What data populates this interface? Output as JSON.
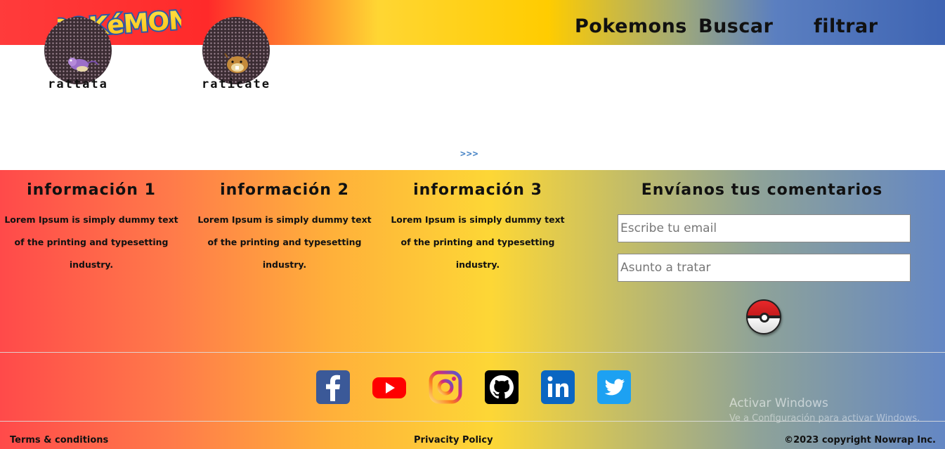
{
  "header": {
    "logo_text": "POKéMON",
    "nav": [
      "Pokemons",
      "Buscar",
      "filtrar"
    ]
  },
  "main": {
    "cards": [
      {
        "name": "rattata"
      },
      {
        "name": "raticate"
      }
    ],
    "next_label": ">>>"
  },
  "footer": {
    "info_columns": [
      {
        "title": "información 1",
        "text": "Lorem Ipsum is simply dummy text of the printing and typesetting industry."
      },
      {
        "title": "información 2",
        "text": "Lorem Ipsum is simply dummy text of the printing and typesetting industry."
      },
      {
        "title": "información 3",
        "text": "Lorem Ipsum is simply dummy text of the printing and typesetting industry."
      }
    ],
    "contact": {
      "title": "Envíanos tus comentarios",
      "email_placeholder": "Escribe tu email",
      "subject_placeholder": "Asunto a tratar"
    },
    "social": [
      {
        "icon": "facebook-icon",
        "color": "#3b5998"
      },
      {
        "icon": "youtube-icon",
        "color": "#ff0000"
      },
      {
        "icon": "instagram-icon",
        "color": "#c13584"
      },
      {
        "icon": "github-icon",
        "color": "#000000"
      },
      {
        "icon": "linkedin-icon",
        "color": "#0a66c2"
      },
      {
        "icon": "twitter-icon",
        "color": "#1da1f2"
      }
    ],
    "terms": "Terms & conditions",
    "privacy": "Privacity Policy",
    "copyright": "©2023 copyright Nowrap Inc."
  },
  "os_watermark": {
    "title": "Activar Windows",
    "subtitle": "Ve a Configuración para activar Windows."
  }
}
